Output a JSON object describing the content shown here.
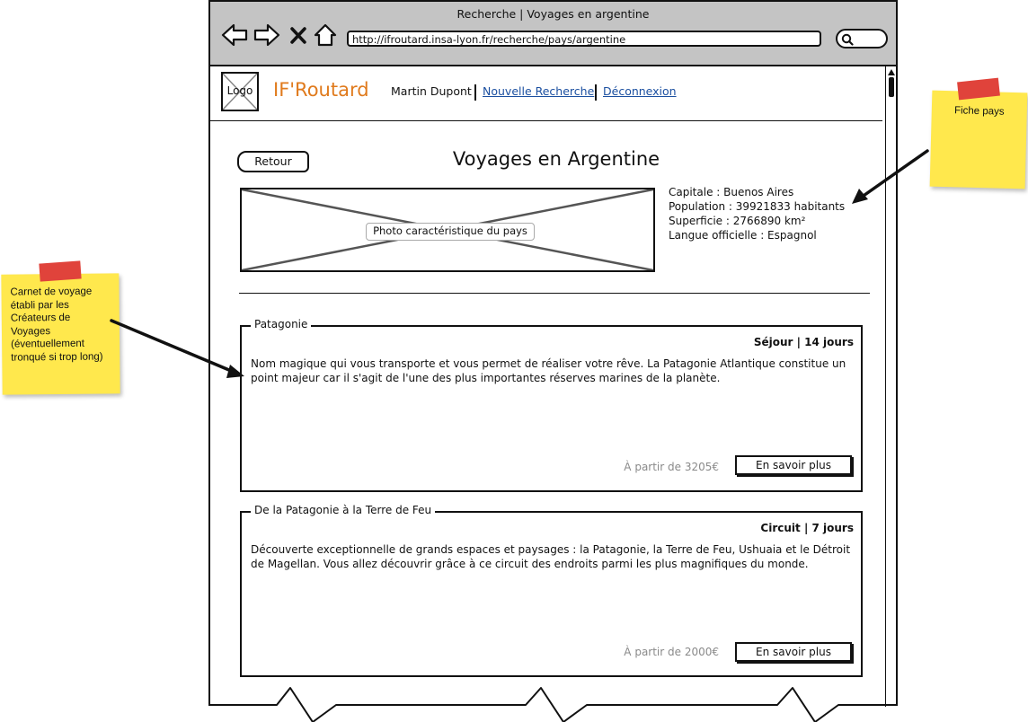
{
  "browser": {
    "window_title": "Recherche | Voyages en argentine",
    "url": "http://ifroutard.insa-lyon.fr/recherche/pays/argentine",
    "icons": [
      "back-arrow-icon",
      "forward-arrow-icon",
      "close-icon",
      "home-icon",
      "search-icon"
    ]
  },
  "header": {
    "logo": "Logo",
    "site_name": "IF'Routard",
    "user_name": "Martin Dupont",
    "nav": {
      "new_search": "Nouvelle Recherche",
      "logout": "Déconnexion"
    },
    "brand_color": "#e07a1c",
    "link_color": "#1b4fa0"
  },
  "page": {
    "back_label": "Retour",
    "title": "Voyages en Argentine",
    "photo_label": "Photo caractéristique du pays",
    "facts": {
      "capital": "Capitale : Buenos Aires",
      "population": "Population : 39921833 habitants",
      "area": "Superficie : 2766890 km²",
      "language": "Langue officielle : Espagnol"
    }
  },
  "trips": [
    {
      "name": "Patagonie",
      "duration": "Séjour | 14 jours",
      "description": "Nom magique qui vous transporte et vous permet de réaliser votre rêve. La Patagonie Atlantique constitue un point majeur car il s'agit de l'une des plus importantes réserves marines de la planète.",
      "price": "À partir de 3205€",
      "button": "En savoir plus"
    },
    {
      "name": "De la Patagonie à la Terre de Feu",
      "duration": "Circuit | 7 jours",
      "description": "Découverte exceptionnelle de grands espaces et paysages : la Patagonie, la Terre de Feu, Ushuaia et le Détroit de Magellan. Vous allez découvrir grâce à ce circuit des endroits parmi les plus magnifiques du monde.",
      "price": "À partir de 2000€",
      "button": "En savoir plus"
    }
  ],
  "annotations": {
    "country_sheet": "Fiche pays",
    "travel_journal": "Carnet de voyage établi par les Créateurs de Voyages (éventuellement tronqué si trop long)",
    "note_color": "#ffe84d",
    "tape_color": "#e0433b"
  }
}
